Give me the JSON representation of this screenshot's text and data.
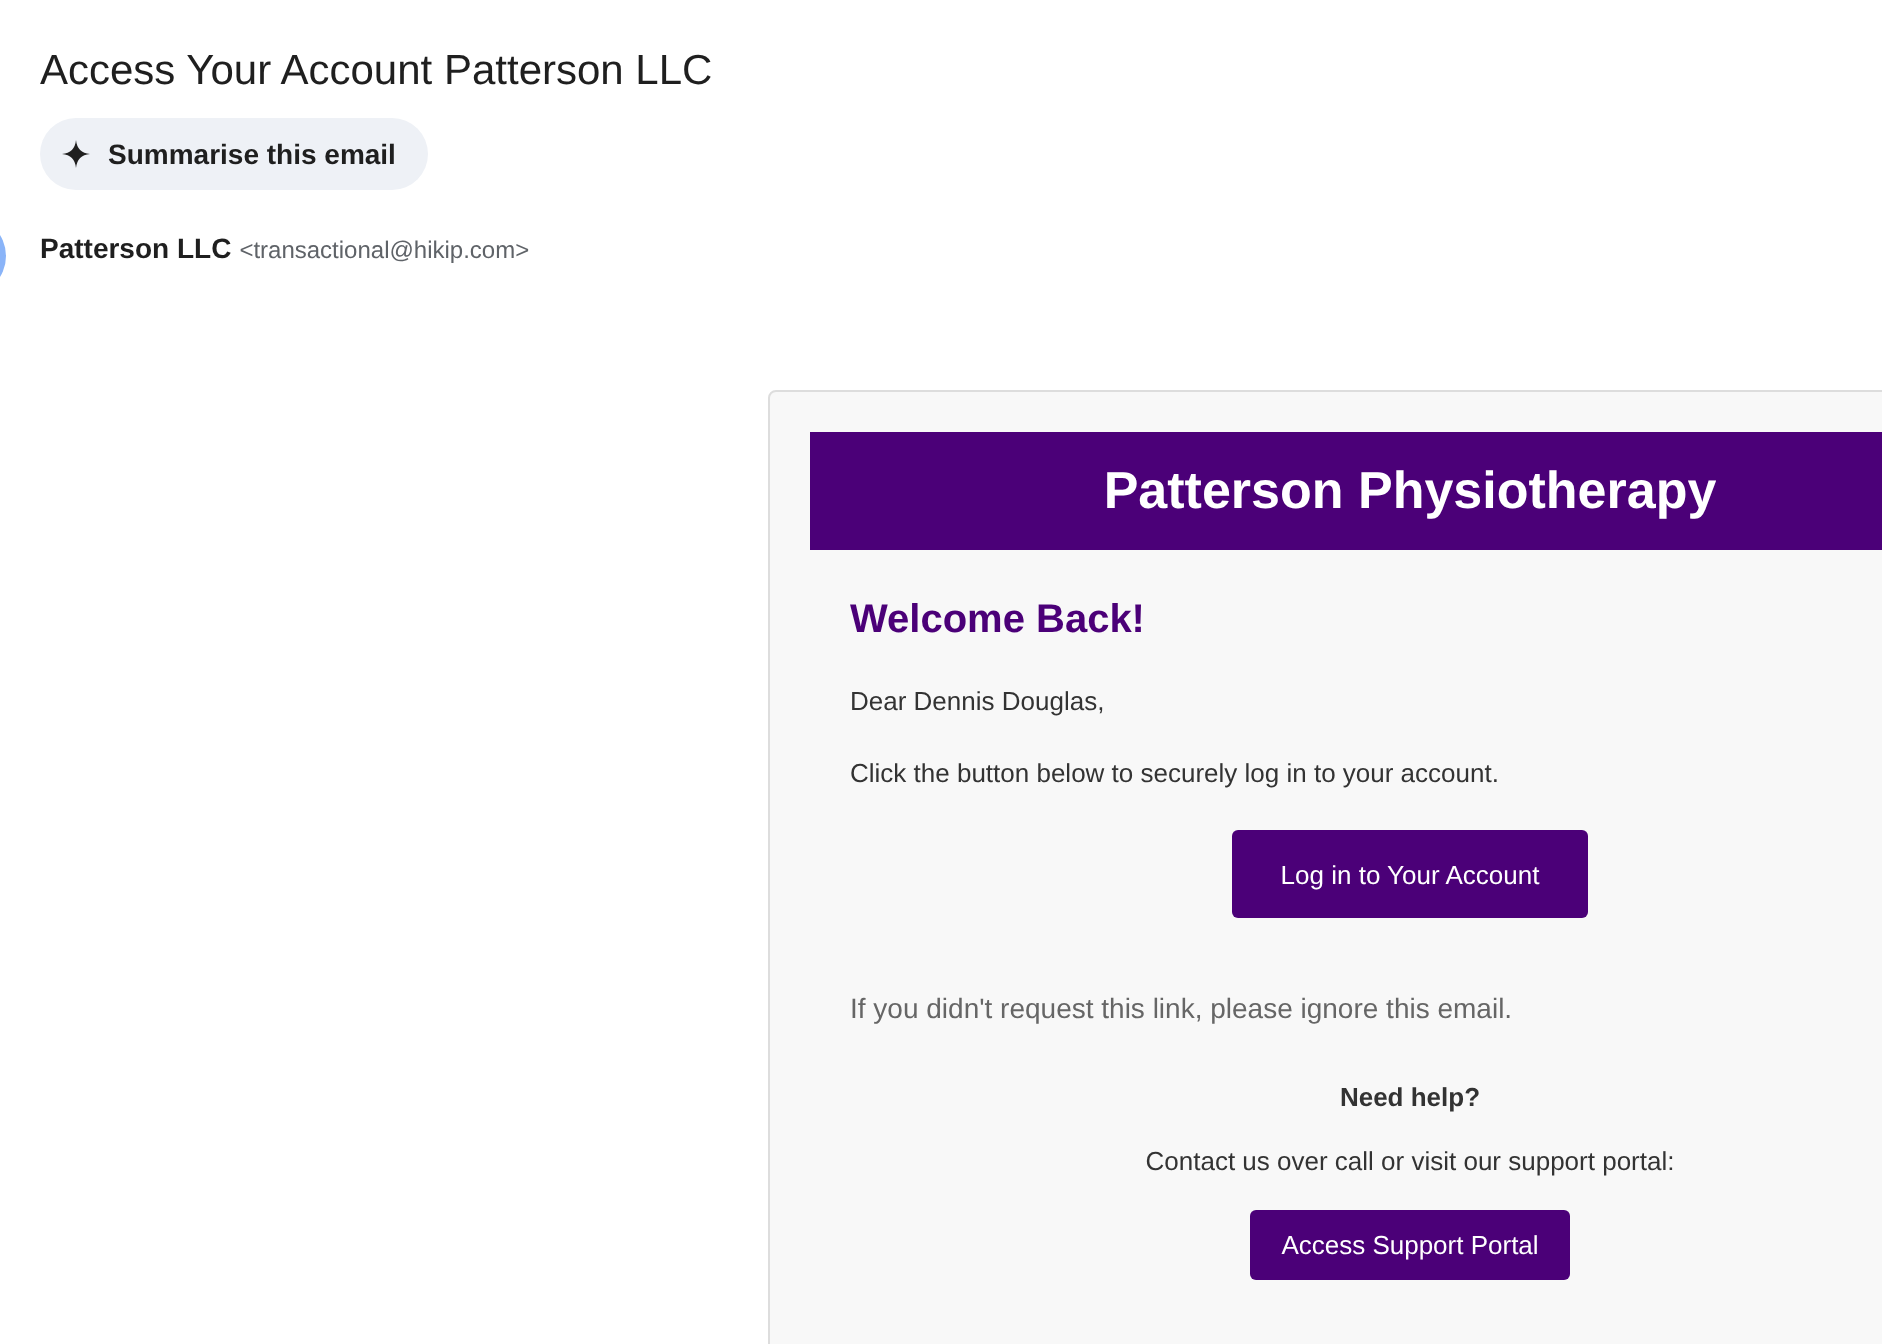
{
  "subject": "Access Your Account Patterson LLC",
  "summarise_button": "Summarise this email",
  "sender": {
    "name": "Patterson LLC",
    "address": "<transactional@hikip.com>"
  },
  "email": {
    "brand": "Patterson Physiotherapy",
    "heading": "Welcome Back!",
    "greeting": "Dear Dennis Douglas,",
    "instruction": "Click the button below to securely log in to your account.",
    "login_button": "Log in to Your Account",
    "ignore_note": "If you didn't request this link, please ignore this email.",
    "help_title": "Need help?",
    "help_text": "Contact us over call or visit our support portal:",
    "support_button": "Access Support Portal"
  }
}
